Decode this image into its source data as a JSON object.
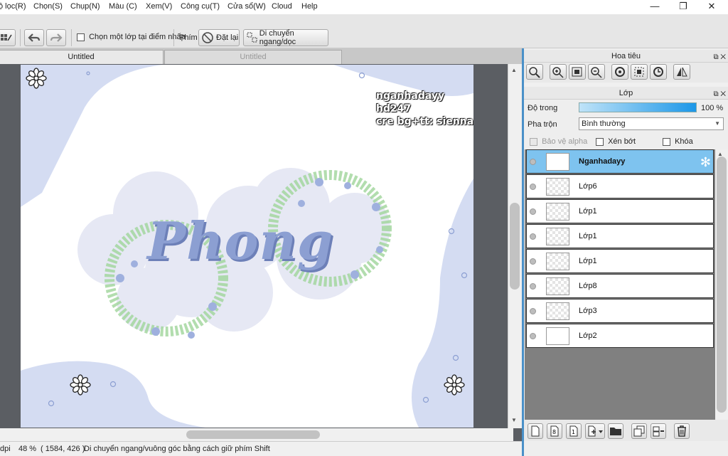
{
  "menubar": {
    "items": [
      "ộ lọc(R)",
      "Chọn(S)",
      "Chụp(N)",
      "Màu (C)",
      "Xem(V)",
      "Công cụ(T)",
      "Cửa sổ(W)",
      "Cloud",
      "Help"
    ],
    "minimize": "—",
    "restore": "❐",
    "close": "✕"
  },
  "toolbar": {
    "select_layer_click_label": "Chọn một lớp tại điểm nhấp",
    "key_label": "Phím",
    "reset_label": "Đặt lại",
    "move_hv_label": "Di chuyển ngang/dọc"
  },
  "tabs": [
    {
      "label": "Untitled",
      "active": true
    },
    {
      "label": "Untitled",
      "active": false
    }
  ],
  "canvas_text": {
    "line1": "nganhadayy",
    "line2": "hd247",
    "line3": "cre bg+tt: sienna",
    "main": "Phong"
  },
  "statusbar": {
    "dpi": "dpi",
    "zoom": "48 %",
    "coords": "( 1584, 426 )",
    "hint": "Di chuyển ngang/vuông góc bằng cách giữ phím Shift"
  },
  "navigator": {
    "title": "Hoa tiêu"
  },
  "layers_panel": {
    "title": "Lớp",
    "opacity_label": "Độ trong",
    "opacity_value": "100 %",
    "opacity_fraction": 1.0,
    "blend_label": "Pha trộn",
    "blend_value": "Bình thường",
    "protect_alpha_label": "Bảo vệ alpha",
    "clipping_label": "Xén bớt",
    "lock_label": "Khóa",
    "layers": [
      {
        "name": "Nganhadayy",
        "active": true
      },
      {
        "name": "Lớp6",
        "active": false
      },
      {
        "name": "Lớp1",
        "active": false
      },
      {
        "name": "Lớp1",
        "active": false
      },
      {
        "name": "Lớp1",
        "active": false
      },
      {
        "name": "Lớp8",
        "active": false
      },
      {
        "name": "Lớp3",
        "active": false
      },
      {
        "name": "Lớp2",
        "active": false
      }
    ]
  },
  "colors": {
    "accent": "#4a90c8",
    "active_layer": "#7ec3ef",
    "canvas_blob": "#d4dcf2",
    "lettering": "#8c9fd2",
    "wreath": "#9fd49a"
  }
}
